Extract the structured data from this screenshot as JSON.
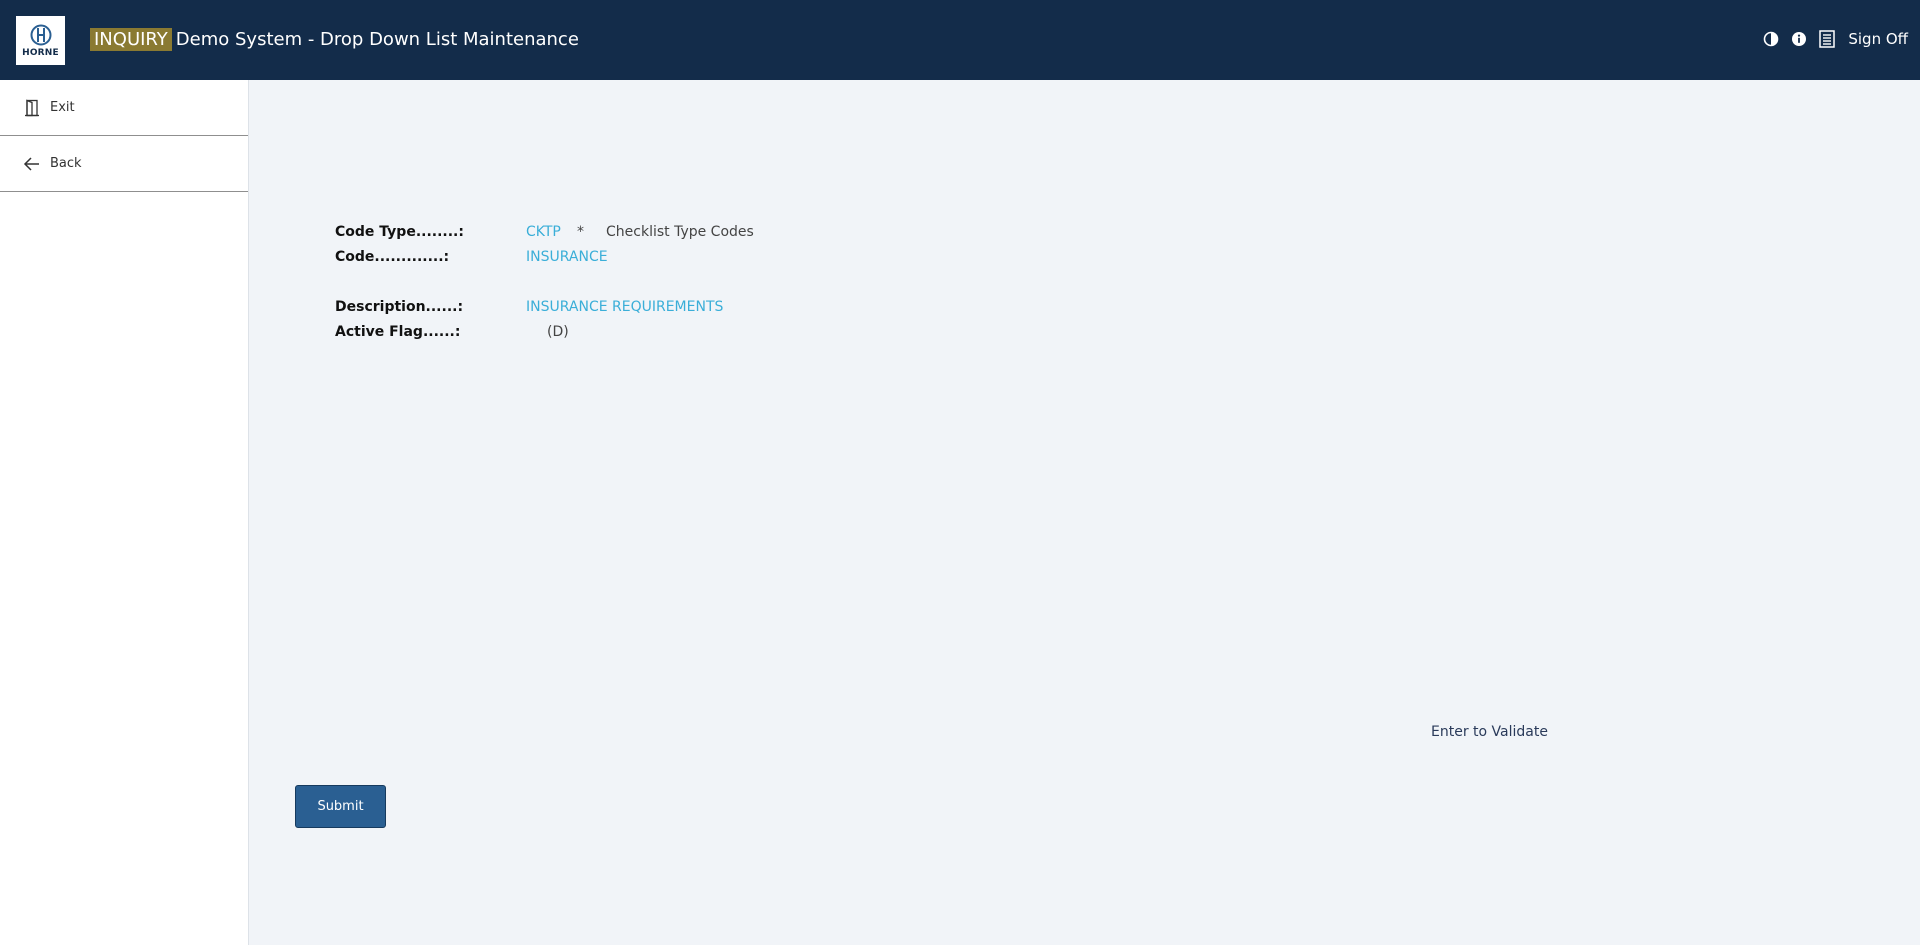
{
  "header": {
    "logo_text": "HORNE",
    "mode": "INQUIRY",
    "title": "Demo System - Drop Down List Maintenance",
    "icons": [
      "contrast-icon",
      "info-icon",
      "list-icon"
    ],
    "sign_off": "Sign Off",
    "colors": {
      "bar": "#132c4a",
      "mode_badge": "#8a7a32"
    }
  },
  "sidebar": {
    "items": [
      {
        "label": "Exit",
        "icon": "door-icon"
      },
      {
        "label": "Back",
        "icon": "arrow-left-icon"
      }
    ]
  },
  "form": {
    "code_type": {
      "label": "Code Type........:",
      "value": "CKTP",
      "marker": "*",
      "desc": "Checklist Type Codes"
    },
    "code": {
      "label": "Code.............:",
      "value": "INSURANCE"
    },
    "description": {
      "label": "Description......:",
      "value": "INSURANCE REQUIREMENTS"
    },
    "active_flag": {
      "label": "Active Flag......:",
      "value": "(D)"
    },
    "value_color": "#3aaed8"
  },
  "hint": "Enter to Validate",
  "submit_label": "Submit"
}
